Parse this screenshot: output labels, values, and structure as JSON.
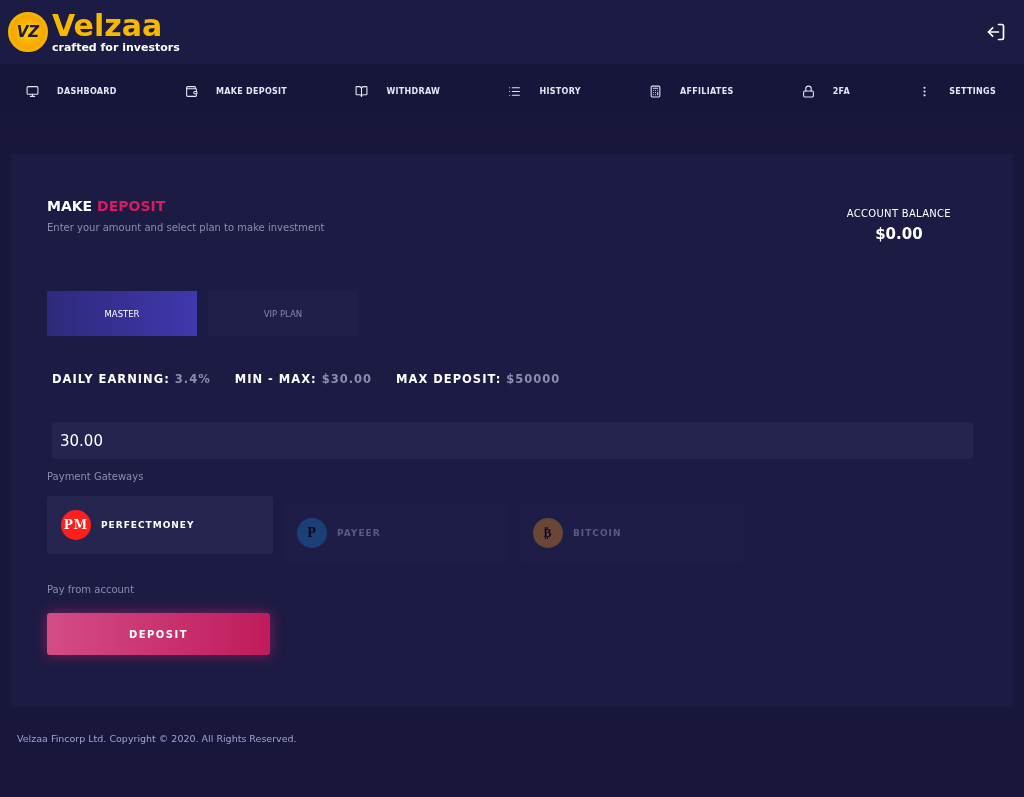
{
  "logo": {
    "mark": "VZ",
    "name": "Velzaa",
    "tagline": "crafted for investors"
  },
  "nav": [
    {
      "label": "DASHBOARD",
      "kind": "monitor"
    },
    {
      "label": "MAKE DEPOSIT",
      "kind": "wallet"
    },
    {
      "label": "WITHDRAW",
      "kind": "book"
    },
    {
      "label": "HISTORY",
      "kind": "list"
    },
    {
      "label": "AFFILIATES",
      "kind": "calculator"
    },
    {
      "label": "2FA",
      "kind": "lock"
    },
    {
      "label": "SETTINGS",
      "kind": "dots"
    }
  ],
  "heading": {
    "first": "MAKE",
    "second": "DEPOSIT",
    "subtitle": "Enter your amount and select plan to make investment"
  },
  "balance": {
    "label": "ACCOUNT BALANCE",
    "value": "$0.00"
  },
  "plans": [
    {
      "label": "MASTER",
      "selected": true
    },
    {
      "label": "VIP PLAN",
      "selected": false
    }
  ],
  "stats": [
    {
      "label": "DAILY EARNING:",
      "value": "3.4%"
    },
    {
      "label": "MIN - MAX:",
      "value": "$30.00"
    },
    {
      "label": "MAX DEPOSIT:",
      "value": "$50000"
    }
  ],
  "amount": {
    "value": "30.00"
  },
  "gateways_label": "Payment Gateways",
  "gateways": [
    {
      "name": "PERFECTMONEY",
      "mark": "PM",
      "color": "#ff1f1f",
      "selected": true
    },
    {
      "name": "PAYEER",
      "mark": "P",
      "color": "#1c3f78",
      "selected": false
    },
    {
      "name": "BITCOIN",
      "mark": "₿",
      "color": "#6a4636",
      "selected": false
    }
  ],
  "pay_from_label": "Pay from account",
  "deposit_button": "DEPOSIT",
  "footer": "Velzaa Fincorp Ltd. Copyright © 2020. All Rights Reserved."
}
